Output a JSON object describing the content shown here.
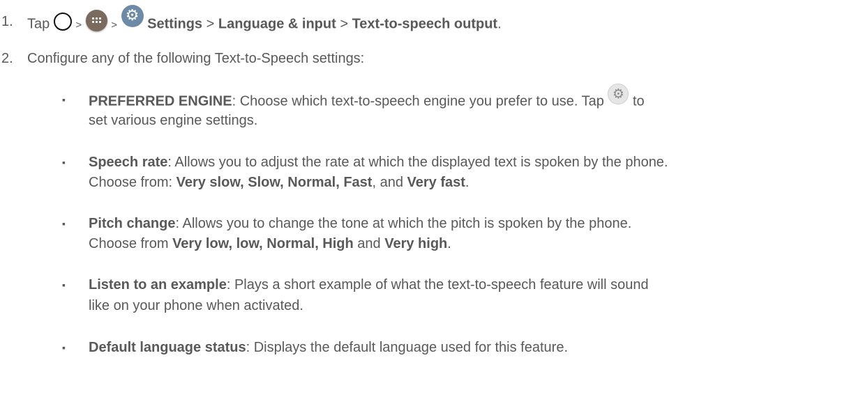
{
  "step1": {
    "number": "1.",
    "tap": "Tap",
    "sep1": ">",
    "sep2": ">",
    "settings": "Settings",
    "sep3": ">",
    "language": "Language & input",
    "sep4": ">",
    "tts_output": "Text-to-speech output",
    "end": ".",
    "icons": [
      "home-icon",
      "apps-icon",
      "settings-icon"
    ]
  },
  "step2": {
    "number": "2.",
    "text": "Configure any of the following Text-to-Speech settings:"
  },
  "bullet_char": "▪",
  "items": [
    {
      "term": "PREFERRED ENGINE",
      "line1": ": Choose which text-to-speech engine you prefer to use. Tap",
      "line1_after_icon": "to",
      "line2": "set various engine settings.",
      "icon": "gear-icon"
    },
    {
      "term": "Speech rate",
      "line1": ": Allows you to adjust the rate at which the displayed text is spoken by the phone.",
      "line2_prefix": "Choose from: ",
      "options": "Very slow, Slow, Normal, Fast",
      "mid": ", and ",
      "last": "Very fast",
      "end": "."
    },
    {
      "term": "Pitch change",
      "line1": ": Allows you to change the tone at which the pitch is spoken by the phone.",
      "line2_prefix": "Choose from ",
      "options": "Very low, low, Normal, High",
      "mid": " and ",
      "last": "Very high",
      "end": "."
    },
    {
      "term": "Listen to an example",
      "line1": ": Plays a short example of what the text-to-speech feature will sound",
      "line2": "like on your phone when activated."
    },
    {
      "term": "Default language status",
      "line1": ": Displays the default language used for this feature."
    }
  ]
}
